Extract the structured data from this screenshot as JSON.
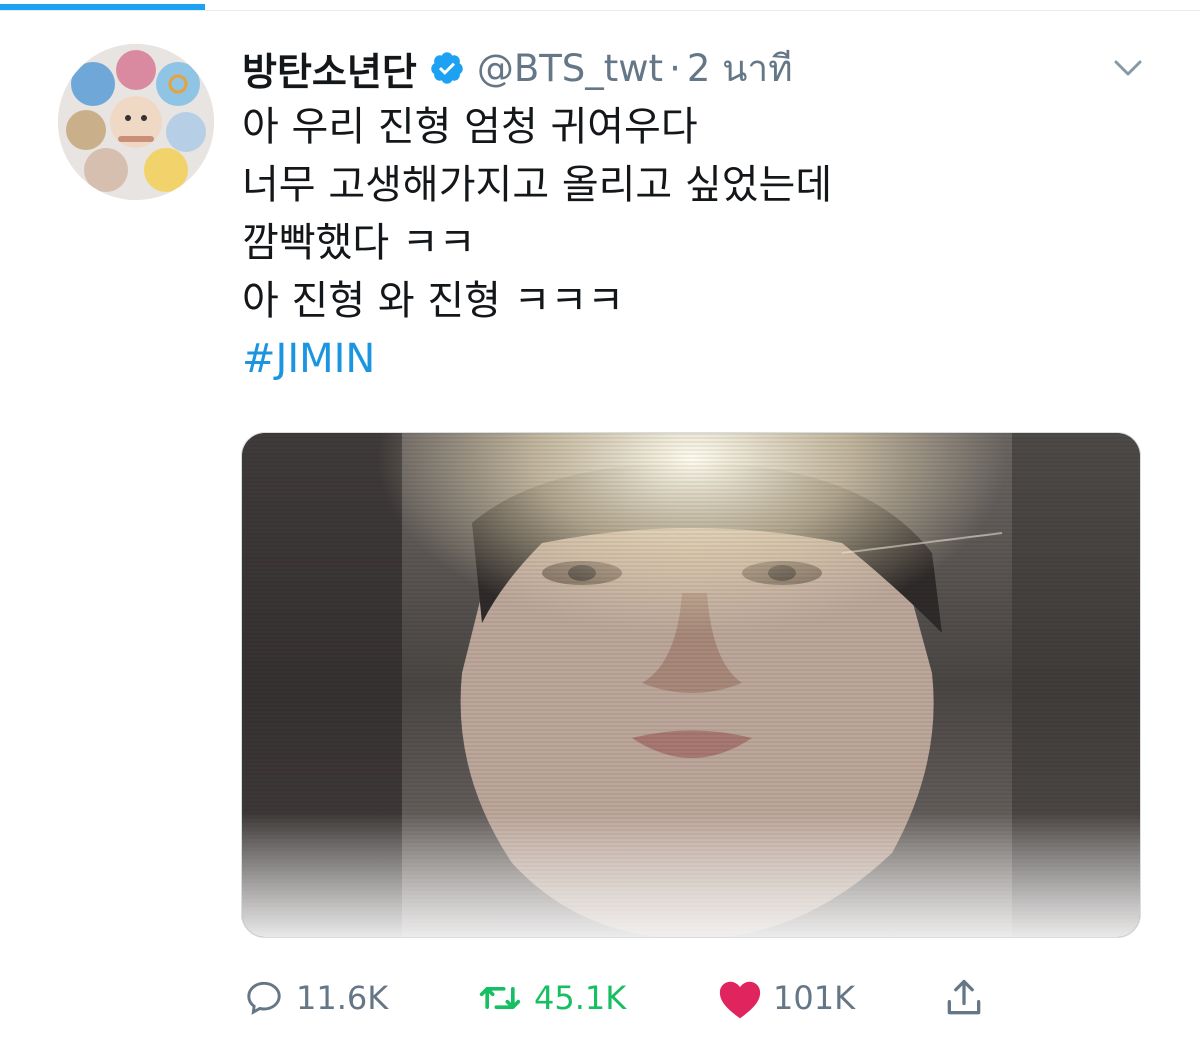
{
  "tweet": {
    "author": {
      "display_name": "방탄소년단",
      "handle": "@BTS_twt",
      "separator": "·",
      "timestamp": "2 นาที",
      "verified": true
    },
    "text_lines": [
      "아 우리 진형 엄청 귀여우다",
      "너무 고생해가지고 올리고 싶었는데",
      "깜빡했다 ㅋㅋ",
      "아 진형 와 진형 ㅋㅋㅋ"
    ],
    "hashtag": "#JIMIN",
    "media": {
      "type": "photo",
      "description_icon": "photo-icon"
    },
    "actions": {
      "reply_count": "11.6K",
      "retweet_count": "45.1K",
      "like_count": "101K"
    }
  },
  "icons": {
    "reply": "reply-icon",
    "retweet": "retweet-icon",
    "like": "heart-icon",
    "share": "share-icon",
    "menu": "chevron-down-icon",
    "verified": "verified-badge-icon"
  },
  "colors": {
    "accent": "#1da1f2",
    "hashtag": "#1b95e0",
    "retweet_active": "#17bf63",
    "like_active": "#e0245e",
    "secondary_text": "#657786",
    "primary_text": "#14171a"
  }
}
